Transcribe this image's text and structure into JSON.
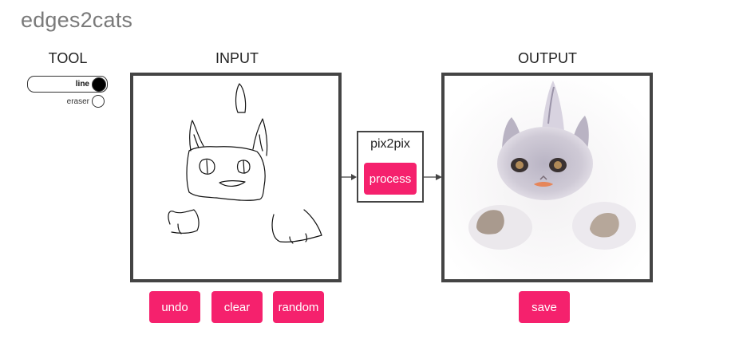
{
  "app": {
    "title": "edges2cats"
  },
  "tool": {
    "label": "TOOL",
    "options": [
      {
        "label": "line",
        "selected": true
      },
      {
        "label": "eraser",
        "selected": false
      }
    ]
  },
  "input": {
    "label": "INPUT",
    "buttons": {
      "undo": "undo",
      "clear": "clear",
      "random": "random"
    }
  },
  "model": {
    "name": "pix2pix",
    "process_label": "process"
  },
  "output": {
    "label": "OUTPUT",
    "save_label": "save"
  },
  "colors": {
    "accent": "#f5216d",
    "border": "#444444",
    "title": "#7a7a7a"
  },
  "icons": [
    "radio-filled-icon",
    "radio-empty-icon",
    "arrow-right-icon"
  ]
}
